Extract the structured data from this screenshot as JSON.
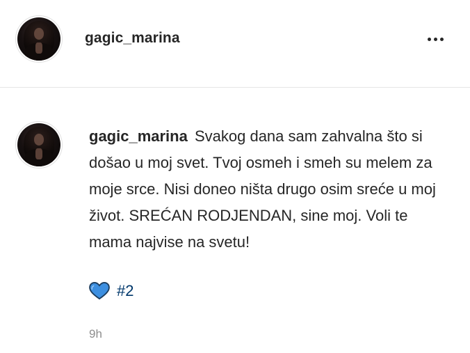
{
  "post": {
    "username": "gagic_marina",
    "more_icon": "more-horizontal-icon"
  },
  "comment": {
    "username": "gagic_marina",
    "text": "Svakog dana sam zahvalna što si došao u moj svet. Tvoj osmeh i smeh su melem za moje srce. Nisi doneo ništa drugo osim sreće u moj život. SREĆAN RODJENDAN, sine moj. Voli te mama najvise na svetu!",
    "emoji": "blue-heart-icon",
    "hashtag": "#2",
    "time": "9h"
  },
  "colors": {
    "text": "#262626",
    "link": "#00376b",
    "muted": "#8e8e8e",
    "heart": "#3d8fe0",
    "divider": "#e6e6e6"
  }
}
